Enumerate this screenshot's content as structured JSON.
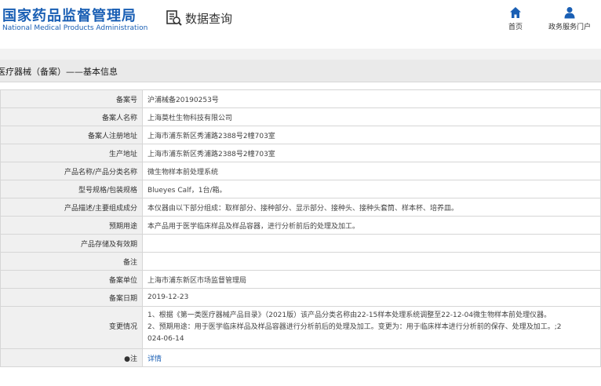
{
  "header": {
    "logo_cn": "国家药品监督管理局",
    "logo_en": "National Medical Products Administration",
    "query_label": "数据查询",
    "query_icon": "search-document-icon",
    "nav": [
      {
        "label": "首页",
        "icon": "home-icon"
      },
      {
        "label": "政务服务门户",
        "icon": "user-icon"
      }
    ],
    "brand_color": "#1a5fb4"
  },
  "section": {
    "title": "医疗器械（备案）——基本信息"
  },
  "rows": [
    {
      "label": "备案号",
      "value": "沪浦械备20190253号"
    },
    {
      "label": "备案人名称",
      "value": "上海莫杜生物科技有限公司"
    },
    {
      "label": "备案人注册地址",
      "value": "上海市浦东新区秀浦路2388号2幢703室"
    },
    {
      "label": "生产地址",
      "value": "上海市浦东新区秀浦路2388号2幢703室"
    },
    {
      "label": "产品名称/产品分类名称",
      "value": "微生物样本前处理系统"
    },
    {
      "label": "型号规格/包装规格",
      "value": "Blueyes Calf，1台/箱。"
    },
    {
      "label": "产品描述/主要组成成分",
      "value": "本仪器由以下部分组成：取样部分、接种部分、显示部分、接种头、接种头套筒、样本杯、培养皿。"
    },
    {
      "label": "预期用途",
      "value": "本产品用于医学临床样品及样品容器，进行分析前后的处理及加工。"
    },
    {
      "label": "产品存储及有效期",
      "value": ""
    },
    {
      "label": "备注",
      "value": ""
    },
    {
      "label": "备案单位",
      "value": "上海市浦东新区市场监督管理局"
    },
    {
      "label": "备案日期",
      "value": "2019-12-23"
    }
  ],
  "change": {
    "label": "变更情况",
    "line1": "1、根据《第一类医疗器械产品目录》（2021版）该产品分类名称由22-15样本处理系统调整至22-12-04微生物样本前处理仪器。",
    "line2": "2、预期用途：用于医学临床样品及样品容器进行分析前后的处理及加工。变更为：用于临床样本进行分析前的保存、处理及加工。;2",
    "line3": "024-06-14"
  },
  "detail": {
    "label": "●注",
    "link": "详情"
  }
}
